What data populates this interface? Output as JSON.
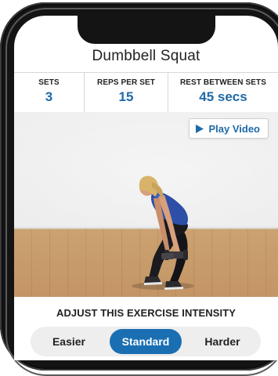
{
  "screen_title": "Dumbbell Squat",
  "stats": [
    {
      "label": "SETS",
      "value": "3"
    },
    {
      "label": "REPS PER SET",
      "value": "15"
    },
    {
      "label": "REST BETWEEN SETS",
      "value": "45 secs"
    }
  ],
  "video": {
    "play_label": "Play Video",
    "play_icon": "play-triangle-icon"
  },
  "intensity": {
    "title": "ADJUST THIS EXERCISE INTENSITY",
    "options": [
      "Easier",
      "Standard",
      "Harder"
    ],
    "selected": "Standard"
  },
  "colors": {
    "accent": "#1e6aa8",
    "selected_pill": "#1a6fb3",
    "phone_frame": "#141414"
  }
}
